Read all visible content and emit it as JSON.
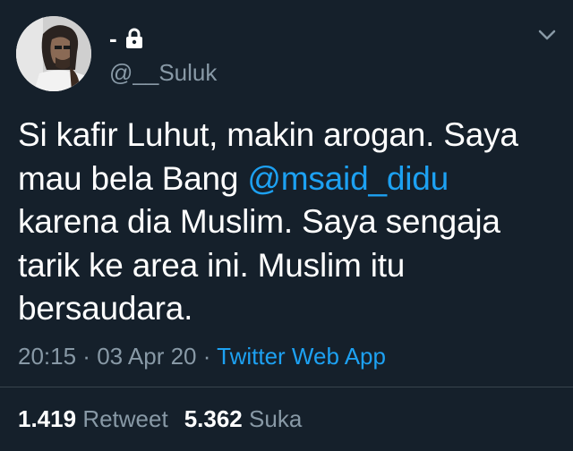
{
  "author": {
    "display_name": "-",
    "handle": "@__Suluk",
    "protected": true
  },
  "tweet": {
    "text_before_mention": "Si kafir Luhut, makin arogan. Saya mau bela Bang ",
    "mention": "@msaid_didu",
    "text_after_mention": " karena dia Muslim. Saya sengaja tarik ke area ini. Muslim itu bersaudara."
  },
  "meta": {
    "time": "20:15",
    "separator": " · ",
    "date": "03 Apr 20",
    "source": "Twitter Web App"
  },
  "stats": {
    "retweets_count": "1.419",
    "retweets_label": "Retweet",
    "likes_count": "5.362",
    "likes_label": "Suka"
  },
  "icons": {
    "lock": "lock-icon",
    "menu": "chevron-down-icon"
  },
  "colors": {
    "background": "#15202b",
    "text": "#ffffff",
    "secondary_text": "#8899a6",
    "link": "#1da1f2"
  }
}
